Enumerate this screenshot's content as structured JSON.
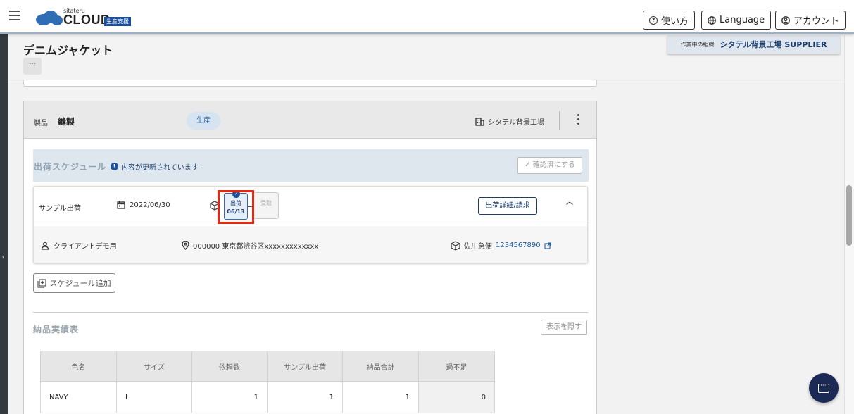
{
  "header": {
    "logo_small": "sitateru",
    "logo_main": "CLOUD",
    "logo_tag": "生産支援",
    "help_label": "使い方",
    "language_label": "Language",
    "account_label": "アカウント"
  },
  "page": {
    "title": "デニムジャケット",
    "more_label": "···",
    "org_label": "作業中の組織",
    "org_name": "シタテル背景工場 SUPPLIER"
  },
  "card": {
    "product_label": "製品",
    "product_name": "縫製",
    "status_badge": "生産",
    "factory": "シタテル背景工場"
  },
  "schedule": {
    "title": "出荷スケジュール",
    "notice": "内容が更新されています",
    "confirm_label": "確認済にする",
    "type": "サンプル出荷",
    "date": "2022/06/30",
    "step_ship_label": "出荷",
    "step_ship_date": "06/13",
    "step_recv_label": "受取",
    "detail_button": "出荷詳細/請求",
    "client": "クライアントデモ用",
    "address": "000000 東京都渋谷区xxxxxxxxxxxxx",
    "carrier": "佐川急便",
    "tracking": "1234567890",
    "add_label": "スケジュール追加"
  },
  "delivery": {
    "title": "納品実績表",
    "hide_label": "表示を隠す",
    "headers": [
      "色名",
      "サイズ",
      "依頼数",
      "サンプル出荷",
      "納品合計",
      "過不足"
    ],
    "rows": [
      [
        "NAVY",
        "L",
        "1",
        "1",
        "1",
        "0"
      ]
    ]
  },
  "colors": {
    "brand_navy": "#1c3f6e",
    "highlight_red": "#e02a14",
    "chat_bg": "#1b2a55"
  }
}
